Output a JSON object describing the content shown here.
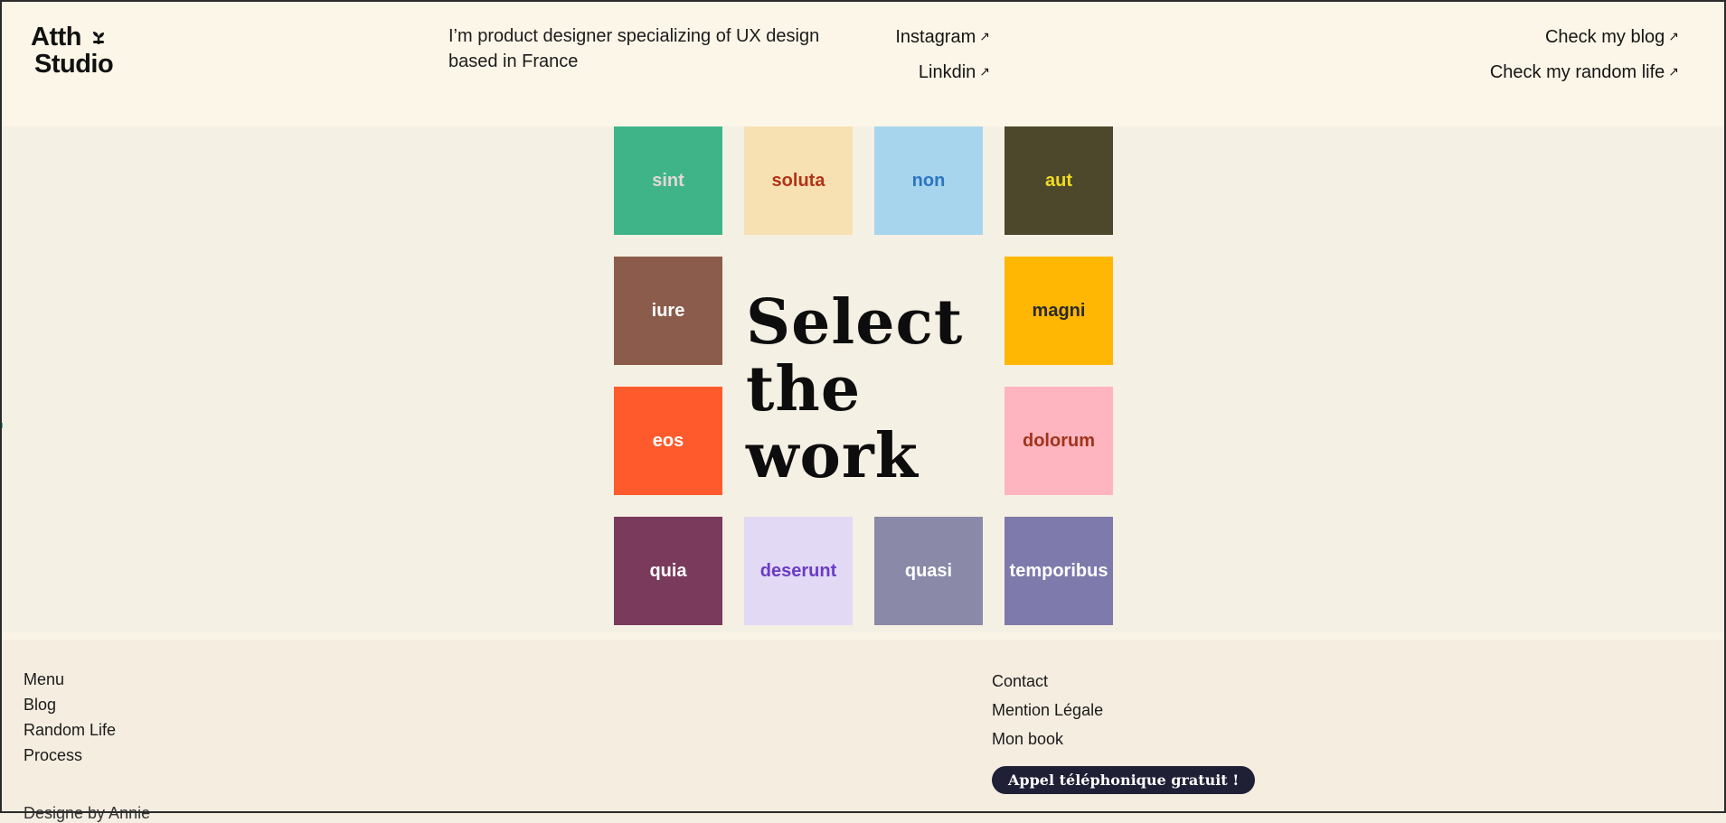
{
  "header": {
    "logo": {
      "line1": "Atth",
      "line2": "Studio"
    },
    "tagline": "I’m product designer specializing of UX design based in France",
    "social": [
      {
        "label": "Instagram",
        "arrow": "↗"
      },
      {
        "label": "Linkdin",
        "arrow": "↗"
      }
    ],
    "blog_links": [
      {
        "label": "Check my blog",
        "arrow": "↗"
      },
      {
        "label": "Check my random life",
        "arrow": "↗"
      }
    ]
  },
  "main": {
    "headline": {
      "line1": "Select",
      "line2": "the",
      "line3": "work"
    },
    "tiles": [
      {
        "label": "sint",
        "bg": "#3fb489",
        "color": "#e2d8d8"
      },
      {
        "label": "soluta",
        "bg": "#f7e1b2",
        "color": "#b2321a"
      },
      {
        "label": "non",
        "bg": "#a7d5ee",
        "color": "#2d74c2"
      },
      {
        "label": "aut",
        "bg": "#4d482b",
        "color": "#f1dc23"
      },
      {
        "label": "iure",
        "bg": "#8b5c4b",
        "color": "#ffffff"
      },
      {
        "label": "magni",
        "bg": "#ffb703",
        "color": "#2a2a2a"
      },
      {
        "label": "eos",
        "bg": "#ff5a2c",
        "color": "#ffffff"
      },
      {
        "label": "dolorum",
        "bg": "#ffb5c0",
        "color": "#a0331b"
      },
      {
        "label": "quia",
        "bg": "#7a3a5b",
        "color": "#ffffff"
      },
      {
        "label": "deserunt",
        "bg": "#e2d9f5",
        "color": "#6b3bc6"
      },
      {
        "label": "quasi",
        "bg": "#8a89a8",
        "color": "#ffffff"
      },
      {
        "label": "temporibus",
        "bg": "#7e7aab",
        "color": "#ffffff"
      }
    ]
  },
  "footer": {
    "menu": [
      "Menu",
      "Blog",
      "Random Life",
      "Process"
    ],
    "contact": [
      "Contact",
      "Mention Légale",
      "Mon book"
    ],
    "cta_label": "Appel téléphonique gratuit !",
    "credits": "Designe by Annie"
  }
}
